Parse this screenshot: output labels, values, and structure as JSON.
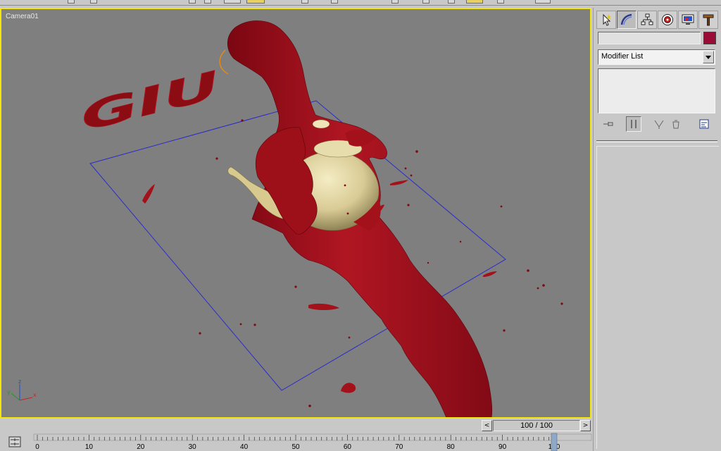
{
  "viewport": {
    "label": "Camera01",
    "scene_text": "GIU",
    "border_color": "#f5e60a",
    "background_color": "#7f7f7f"
  },
  "command_panel": {
    "tabs": [
      {
        "name": "create",
        "icon": "create-pointer-icon"
      },
      {
        "name": "modify",
        "icon": "modify-arc-icon"
      },
      {
        "name": "hierarchy",
        "icon": "hierarchy-icon"
      },
      {
        "name": "motion",
        "icon": "motion-icon"
      },
      {
        "name": "display",
        "icon": "display-icon"
      },
      {
        "name": "utilities",
        "icon": "utilities-hammer-icon"
      }
    ],
    "active_tab": "modify",
    "object_name": "",
    "object_color": "#9a0b36",
    "modifier_list_label": "Modifier List",
    "stack_tools": [
      "pin-stack-icon",
      "show-end-result-icon",
      "make-unique-icon",
      "remove-modifier-icon",
      "configure-modifier-sets-icon"
    ]
  },
  "time_slider": {
    "prev_label": "<",
    "next_label": ">",
    "frame_display": "100 / 100",
    "current_frame": 100,
    "total_frames": 100
  },
  "track_bar": {
    "ticks": [
      "0",
      "10",
      "20",
      "30",
      "40",
      "50",
      "60",
      "70",
      "80",
      "90",
      "100"
    ]
  }
}
